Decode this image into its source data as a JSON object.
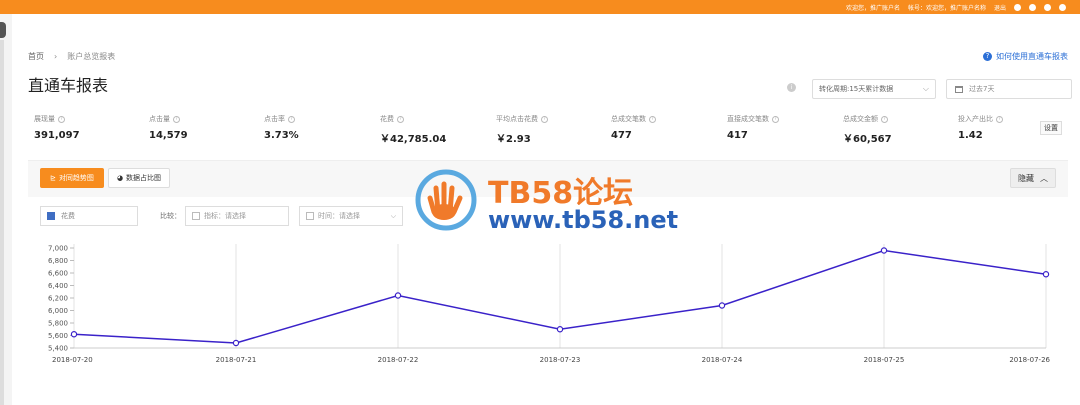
{
  "topbar": {
    "links": [
      "欢迎您，推广账户名",
      "帐号：欢迎您，推广账户名称",
      "退出"
    ],
    "icons": [
      "message-icon",
      "help-icon",
      "settings-icon",
      "user-icon"
    ]
  },
  "breadcrumb": {
    "home": "首页",
    "separator": "›",
    "current": "账户总览报表"
  },
  "help_link": "如何使用直通车报表",
  "page_title": "直通车报表",
  "period_select": {
    "value": "转化周期:15天累计数据"
  },
  "date_select": {
    "placeholder": "过去7天"
  },
  "metrics": [
    {
      "label": "展现量",
      "value": "391,097"
    },
    {
      "label": "点击量",
      "value": "14,579"
    },
    {
      "label": "点击率",
      "value": "3.73%"
    },
    {
      "label": "花费",
      "value": "￥42,785.04"
    },
    {
      "label": "平均点击花费",
      "value": "￥2.93"
    },
    {
      "label": "总成交笔数",
      "value": "477"
    },
    {
      "label": "直接成交笔数",
      "value": "417"
    },
    {
      "label": "总成交金额",
      "value": "￥60,567"
    },
    {
      "label": "投入产出比",
      "value": "1.42"
    }
  ],
  "settings_label": "设置",
  "chart_panel": {
    "tab_trend": "对同趋势图",
    "tab_share": "数据占比图",
    "hide_label": "隐藏",
    "metric_select": "花费",
    "compare_label": "比较：",
    "indicator_select": "指标：请选择",
    "time_select": "时间：请选择"
  },
  "watermark": {
    "title": "TB58论坛",
    "url": "www.tb58.net"
  },
  "colors": {
    "accent": "#f78c1e",
    "series": "#3a22c9",
    "link": "#2b6fd6"
  },
  "chart_data": {
    "type": "line",
    "x": [
      "2018-07-20",
      "2018-07-21",
      "2018-07-22",
      "2018-07-23",
      "2018-07-24",
      "2018-07-25",
      "2018-07-26"
    ],
    "series": [
      {
        "name": "花费",
        "values": [
          5620,
          5480,
          6240,
          5700,
          6080,
          6960,
          6580
        ]
      }
    ],
    "yticks": [
      5400,
      5600,
      5800,
      6000,
      6200,
      6400,
      6600,
      6800,
      7000
    ],
    "ytick_labels": [
      "5,400",
      "5,600",
      "5,800",
      "6,000",
      "6,200",
      "6,400",
      "6,600",
      "6,800",
      "7,000"
    ],
    "ylim": [
      5400,
      7000
    ],
    "grid": "vertical"
  }
}
